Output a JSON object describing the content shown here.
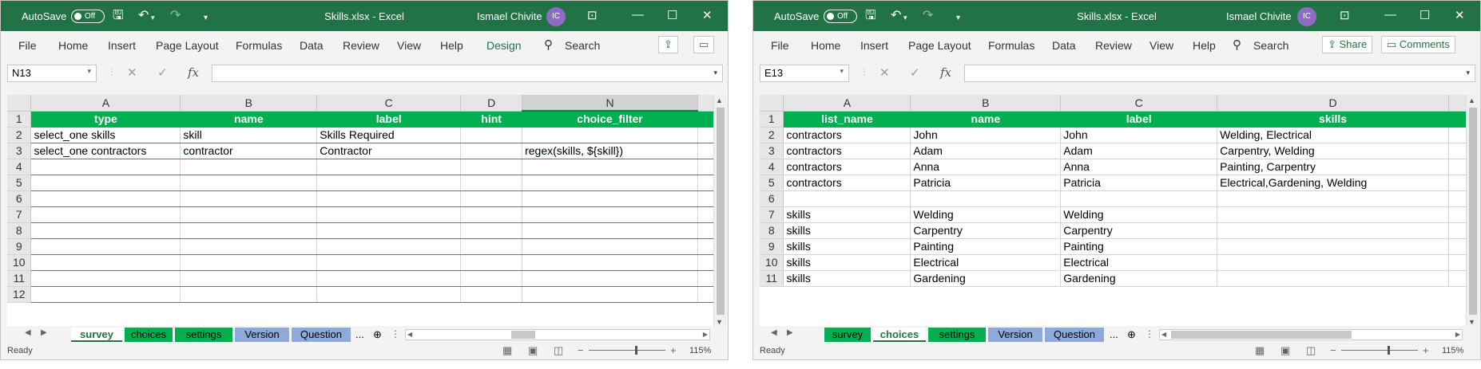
{
  "left": {
    "autosave_label": "AutoSave",
    "autosave_state": "Off",
    "title": "Skills.xlsx  -  Excel",
    "user": "Ismael Chivite",
    "initials": "IC",
    "tabs": [
      "File",
      "Home",
      "Insert",
      "Page Layout",
      "Formulas",
      "Data",
      "Review",
      "View",
      "Help",
      "Design"
    ],
    "search": "Search",
    "namebox": "N13",
    "fx": "fx",
    "columns": [
      "A",
      "B",
      "C",
      "D",
      "N"
    ],
    "rows": [
      [
        "type",
        "name",
        "label",
        "hint",
        "choice_filter"
      ],
      [
        "select_one skills",
        "skill",
        "Skills Required",
        "",
        ""
      ],
      [
        "select_one contractors",
        "contractor",
        "Contractor",
        "",
        "regex(skills, ${skill})"
      ],
      [
        "",
        "",
        "",
        "",
        ""
      ],
      [
        "",
        "",
        "",
        "",
        ""
      ],
      [
        "",
        "",
        "",
        "",
        ""
      ],
      [
        "",
        "",
        "",
        "",
        ""
      ],
      [
        "",
        "",
        "",
        "",
        ""
      ],
      [
        "",
        "",
        "",
        "",
        ""
      ],
      [
        "",
        "",
        "",
        "",
        ""
      ],
      [
        "",
        "",
        "",
        "",
        ""
      ],
      [
        "",
        "",
        "",
        "",
        ""
      ]
    ],
    "row_numbers": [
      "1",
      "2",
      "3",
      "4",
      "5",
      "6",
      "7",
      "8",
      "9",
      "10",
      "11",
      "12"
    ],
    "sheets": [
      "survey",
      "choices",
      "settings",
      "Version",
      "Question"
    ],
    "more": "...",
    "status": "Ready",
    "zoom": "115%"
  },
  "right": {
    "autosave_label": "AutoSave",
    "autosave_state": "Off",
    "title": "Skills.xlsx  -  Excel",
    "user": "Ismael Chivite",
    "initials": "IC",
    "tabs": [
      "File",
      "Home",
      "Insert",
      "Page Layout",
      "Formulas",
      "Data",
      "Review",
      "View",
      "Help"
    ],
    "search": "Search",
    "share": "Share",
    "comments": "Comments",
    "namebox": "E13",
    "fx": "fx",
    "columns": [
      "A",
      "B",
      "C",
      "D"
    ],
    "rows": [
      [
        "list_name",
        "name",
        "label",
        "skills"
      ],
      [
        "contractors",
        "John",
        "John",
        "Welding, Electrical"
      ],
      [
        "contractors",
        "Adam",
        "Adam",
        "Carpentry, Welding"
      ],
      [
        "contractors",
        "Anna",
        "Anna",
        "Painting, Carpentry"
      ],
      [
        "contractors",
        "Patricia",
        "Patricia",
        "Electrical,Gardening, Welding"
      ],
      [
        "",
        "",
        "",
        ""
      ],
      [
        "skills",
        "Welding",
        "Welding",
        ""
      ],
      [
        "skills",
        "Carpentry",
        "Carpentry",
        ""
      ],
      [
        "skills",
        "Painting",
        "Painting",
        ""
      ],
      [
        "skills",
        "Electrical",
        "Electrical",
        ""
      ],
      [
        "skills",
        "Gardening",
        "Gardening",
        ""
      ]
    ],
    "row_numbers": [
      "1",
      "2",
      "3",
      "4",
      "5",
      "6",
      "7",
      "8",
      "9",
      "10",
      "11"
    ],
    "sheets": [
      "survey",
      "choices",
      "settings",
      "Version",
      "Question"
    ],
    "more": "...",
    "status": "Ready",
    "zoom": "115%"
  },
  "colors": {
    "excel_green": "#217346",
    "header_green": "#00b050",
    "tab_blue": "#8eaadb"
  }
}
